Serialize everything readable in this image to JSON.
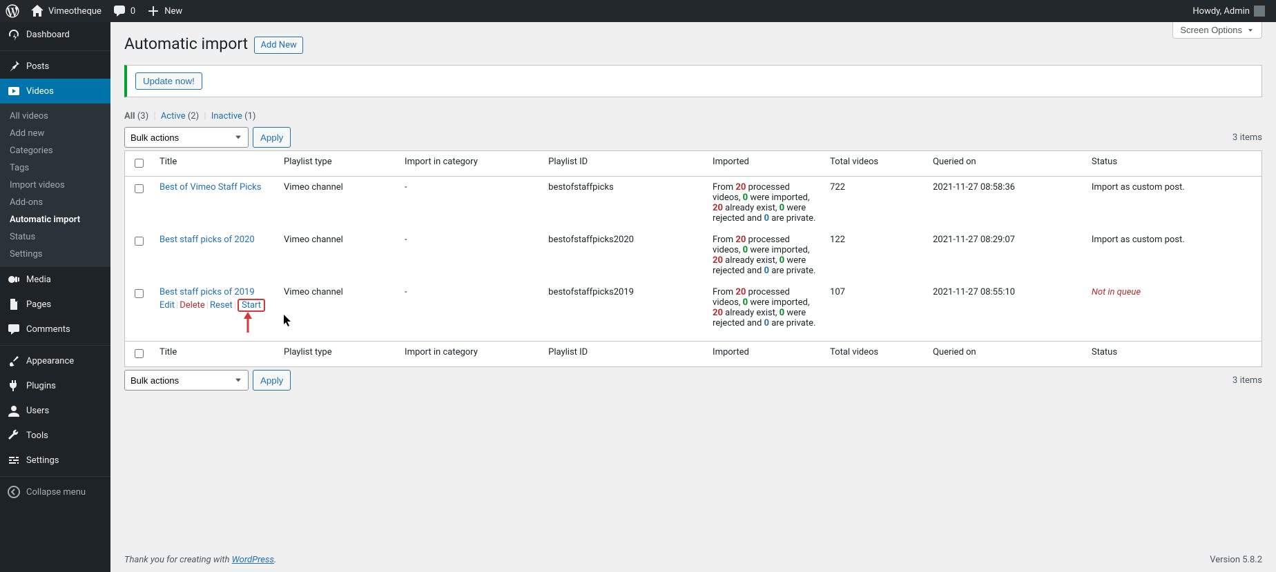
{
  "adminbar": {
    "site_name": "Vimeotheque",
    "comments": "0",
    "new_label": "New",
    "howdy": "Howdy, Admin"
  },
  "sidebar": {
    "dashboard": "Dashboard",
    "posts": "Posts",
    "videos": "Videos",
    "videos_sub": {
      "all_videos": "All videos",
      "add_new": "Add new",
      "categories": "Categories",
      "tags": "Tags",
      "import_videos": "Import videos",
      "addons": "Add-ons",
      "automatic_import": "Automatic import",
      "status": "Status",
      "settings": "Settings"
    },
    "media": "Media",
    "pages": "Pages",
    "comments": "Comments",
    "appearance": "Appearance",
    "plugins": "Plugins",
    "users": "Users",
    "tools": "Tools",
    "settings": "Settings",
    "collapse": "Collapse menu"
  },
  "page": {
    "title": "Automatic import",
    "add_new": "Add New",
    "screen_options": "Screen Options",
    "update_now": "Update now!",
    "filters": {
      "all_label": "All",
      "all_count": "(3)",
      "active_label": "Active",
      "active_count": "(2)",
      "inactive_label": "Inactive",
      "inactive_count": "(1)"
    },
    "bulk_label": "Bulk actions",
    "apply_label": "Apply",
    "items_label": "3 items"
  },
  "columns": {
    "title": "Title",
    "type": "Playlist type",
    "category": "Import in category",
    "playlist_id": "Playlist ID",
    "imported": "Imported",
    "total": "Total videos",
    "queried": "Queried on",
    "status": "Status"
  },
  "row_actions": {
    "edit": "Edit",
    "delete": "Delete",
    "reset": "Reset",
    "start": "Start"
  },
  "rows": [
    {
      "title": "Best of Vimeo Staff Picks",
      "type": "Vimeo channel",
      "category": "-",
      "playlist_id": "bestofstaffpicks",
      "imported": {
        "processed": "20",
        "imported": "0",
        "exist": "20",
        "rejected": "0",
        "private": "0"
      },
      "total": "722",
      "queried": "2021-11-27 08:58:36",
      "status": "Import as custom post.",
      "status_class": "",
      "show_actions": false
    },
    {
      "title": "Best staff picks of 2020",
      "type": "Vimeo channel",
      "category": "-",
      "playlist_id": "bestofstaffpicks2020",
      "imported": {
        "processed": "20",
        "imported": "0",
        "exist": "20",
        "rejected": "0",
        "private": "0"
      },
      "total": "122",
      "queried": "2021-11-27 08:29:07",
      "status": "Import as custom post.",
      "status_class": "",
      "show_actions": false
    },
    {
      "title": "Best staff picks of 2019",
      "type": "Vimeo channel",
      "category": "-",
      "playlist_id": "bestofstaffpicks2019",
      "imported": {
        "processed": "20",
        "imported": "0",
        "exist": "20",
        "rejected": "0",
        "private": "0"
      },
      "total": "107",
      "queried": "2021-11-27 08:55:10",
      "status": "Not in queue",
      "status_class": "status-low",
      "show_actions": true
    }
  ],
  "footer": {
    "thanks_pre": "Thank you for creating with ",
    "wp": "WordPress",
    "dot": ".",
    "version": "Version 5.8.2"
  }
}
